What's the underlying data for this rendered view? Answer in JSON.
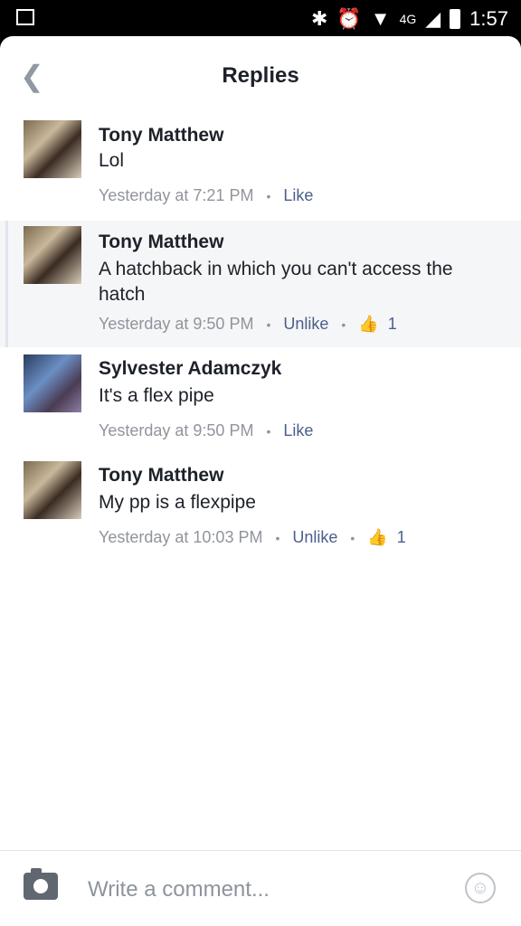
{
  "status_bar": {
    "time": "1:57",
    "network": "4G",
    "icons": [
      "image-icon",
      "bluetooth-icon",
      "alarm-icon",
      "wifi-icon",
      "signal-icon",
      "battery-icon"
    ]
  },
  "header": {
    "title": "Replies",
    "back_icon": "chevron-left-icon"
  },
  "comments": [
    {
      "author": "Tony Matthew",
      "text": "Lol",
      "timestamp": "Yesterday at 7:21 PM",
      "action": "Like"
    },
    {
      "author": "Tony Matthew",
      "text": "A hatchback in which you can't access the hatch",
      "timestamp": "Yesterday at 9:50 PM",
      "action": "Unlike",
      "likes": "1"
    },
    {
      "author": "Sylvester Adamczyk",
      "text": "It's a flex pipe",
      "timestamp": "Yesterday at 9:50 PM",
      "action": "Like"
    },
    {
      "author": "Tony Matthew",
      "text": "My pp is a flexpipe",
      "timestamp": "Yesterday at 10:03 PM",
      "action": "Unlike",
      "likes": "1"
    }
  ],
  "composer": {
    "placeholder": "Write a comment..."
  },
  "colors": {
    "link": "#4b5f8a",
    "meta": "#90949c",
    "text": "#1d2129"
  }
}
